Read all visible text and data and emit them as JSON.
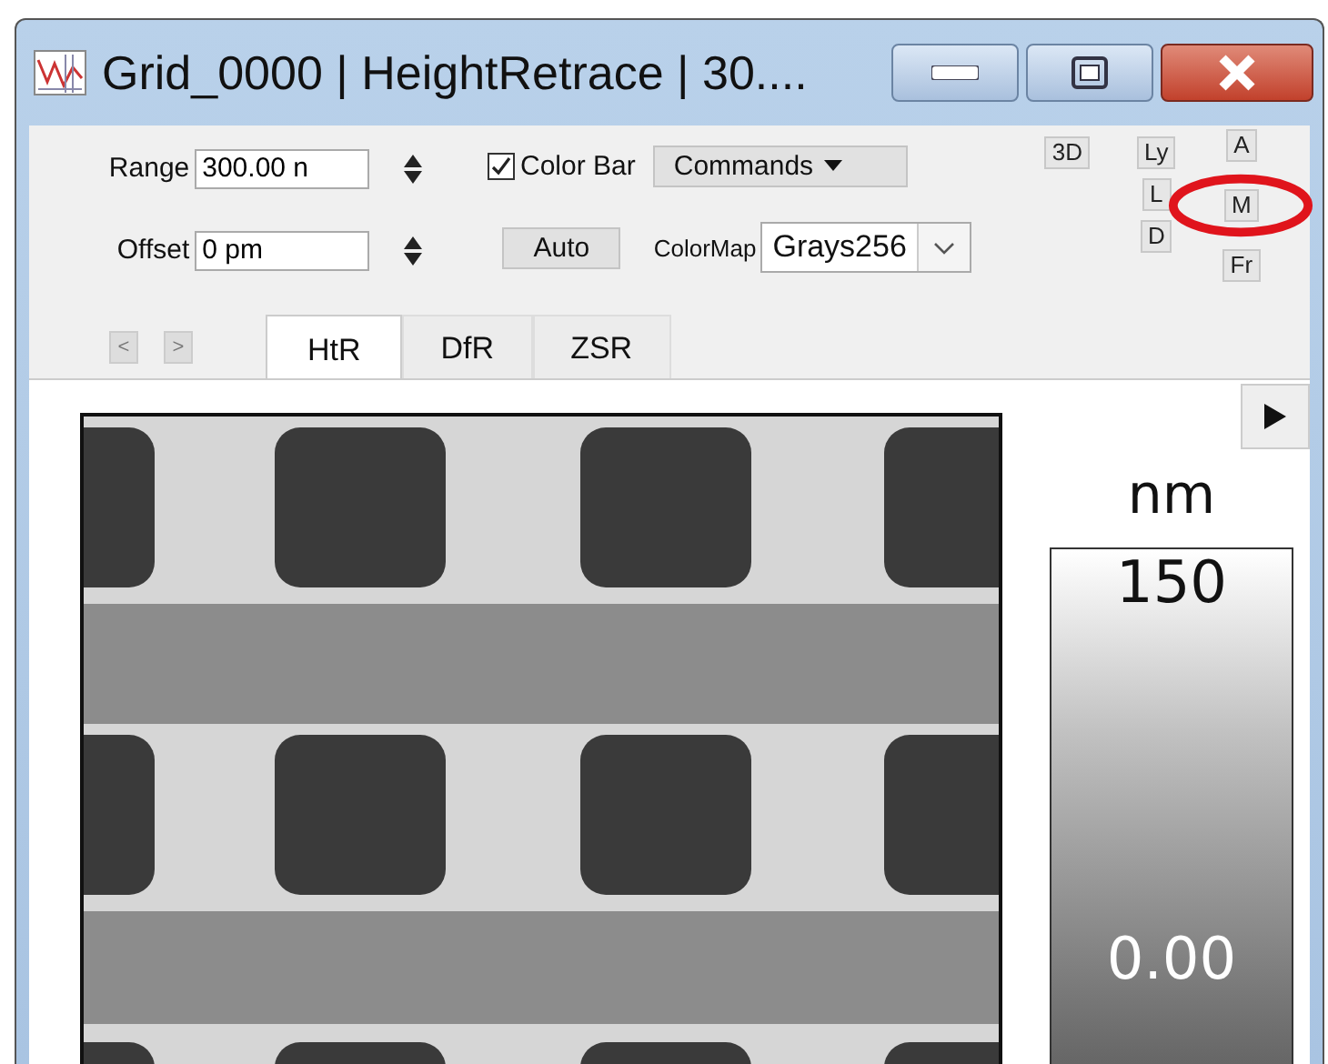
{
  "window": {
    "title": "Grid_0000 | HeightRetrace | 30...."
  },
  "controls": {
    "range": {
      "label": "Range",
      "value": "300.00 n"
    },
    "offset": {
      "label": "Offset",
      "value": "0 pm"
    },
    "color_bar": {
      "label": "Color Bar",
      "checked": true
    },
    "commands": {
      "label": "Commands"
    },
    "auto": {
      "label": "Auto"
    },
    "colormap": {
      "label": "ColorMap",
      "value": "Grays256"
    },
    "view_buttons": [
      {
        "label": "3D"
      }
    ],
    "layer_buttons": [
      {
        "label": "Ly"
      },
      {
        "label": "L"
      },
      {
        "label": "D"
      }
    ],
    "mode_buttons": [
      {
        "label": "A"
      },
      {
        "label": "M"
      },
      {
        "label": "Fr"
      }
    ]
  },
  "tabs": [
    {
      "label": "HtR",
      "selected": true
    },
    {
      "label": "DfR",
      "selected": false
    },
    {
      "label": "ZSR",
      "selected": false
    }
  ],
  "nav_buttons": [
    {
      "label": "<"
    },
    {
      "label": ">"
    }
  ],
  "color_scale": {
    "unit": "nm",
    "max": "150",
    "min": "0.00"
  }
}
